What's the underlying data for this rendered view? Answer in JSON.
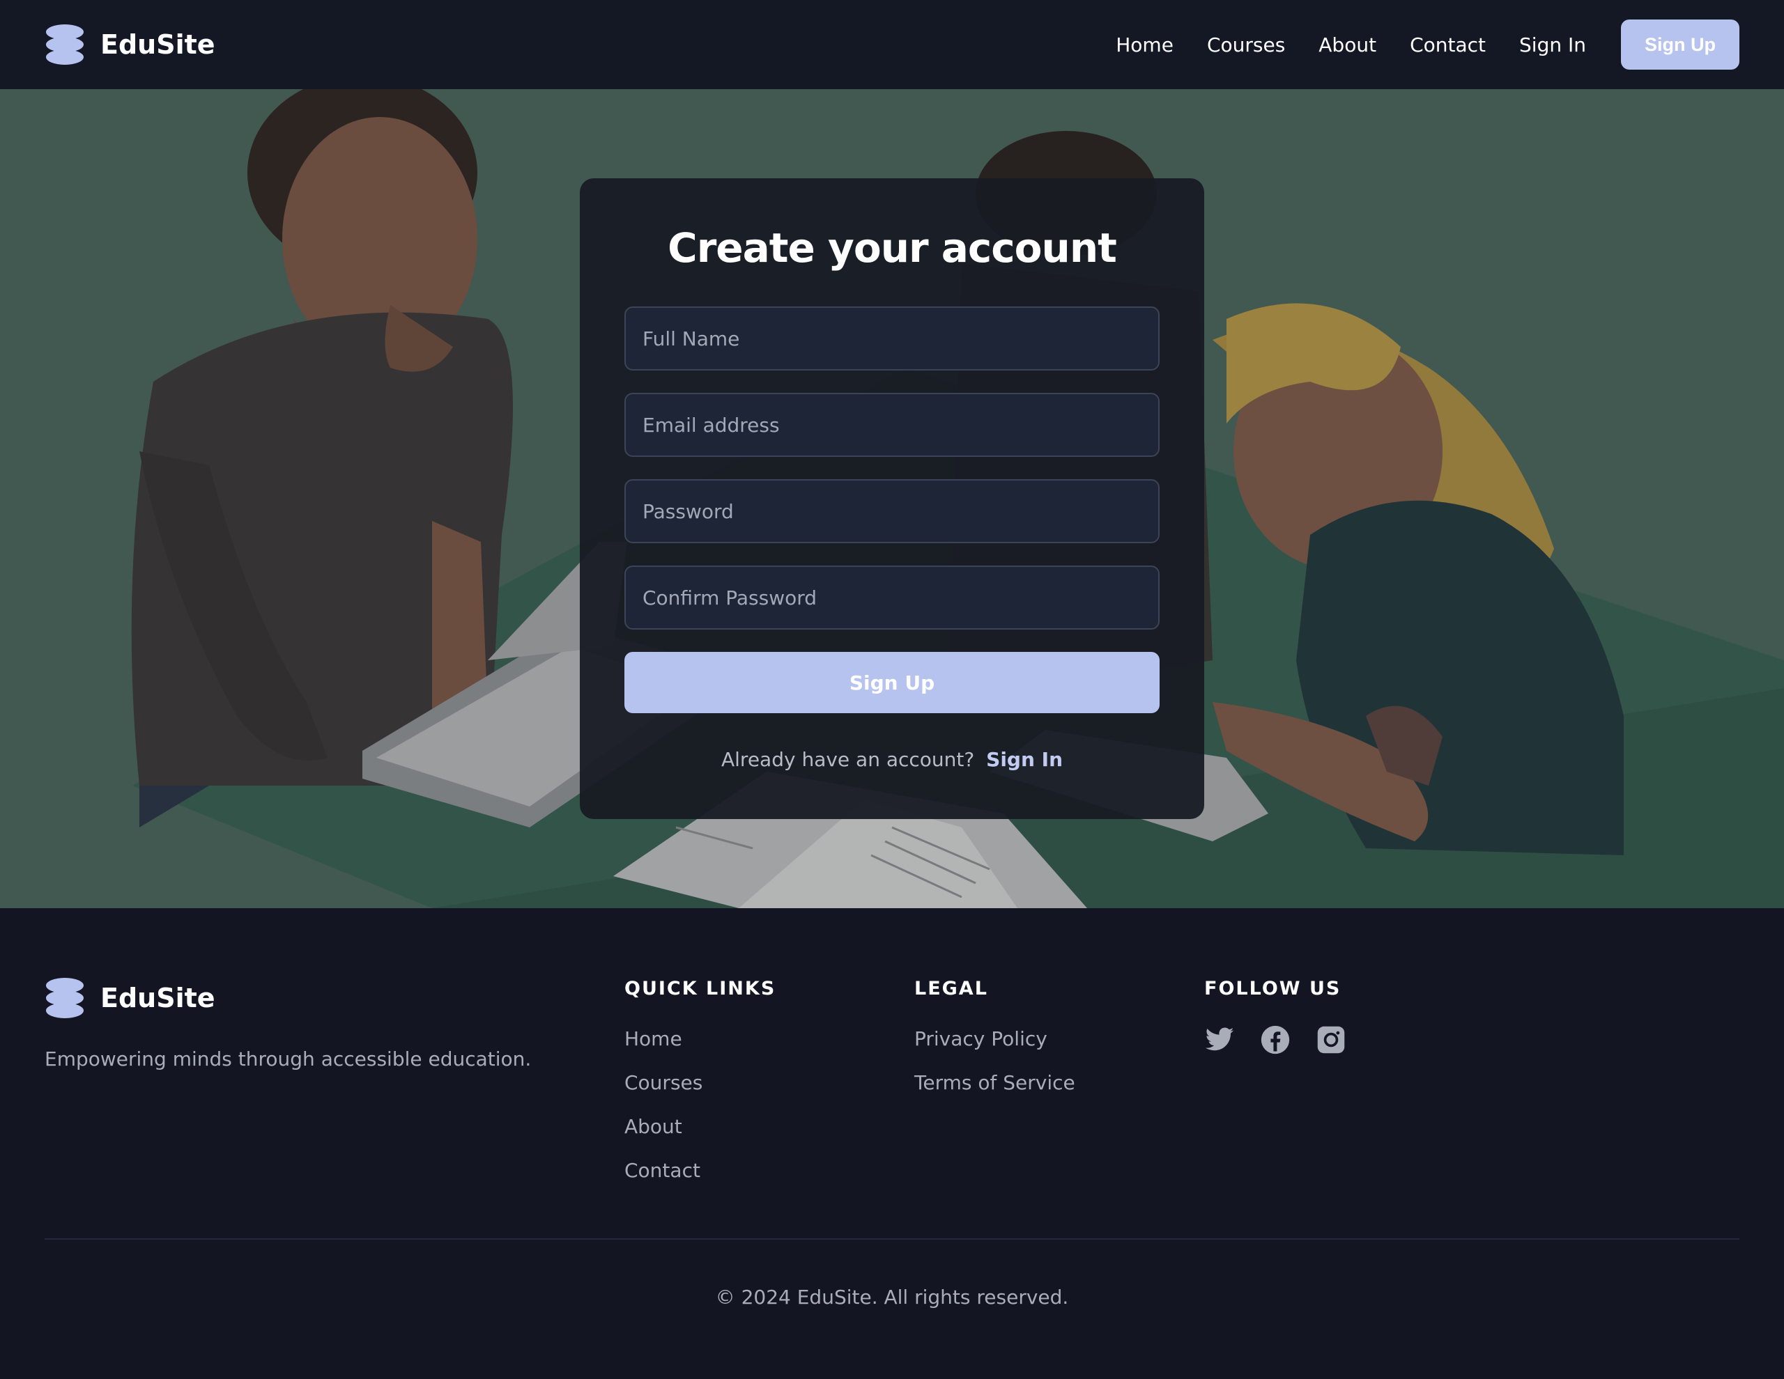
{
  "brand": {
    "name": "EduSite",
    "logo_icon": "stacked-layers-icon"
  },
  "nav": {
    "links": [
      "Home",
      "Courses",
      "About",
      "Contact",
      "Sign In"
    ],
    "signup_label": "Sign Up"
  },
  "form": {
    "title": "Create your account",
    "fields": {
      "full_name": {
        "placeholder": "Full Name",
        "value": ""
      },
      "email": {
        "placeholder": "Email address",
        "value": ""
      },
      "password": {
        "placeholder": "Password",
        "value": ""
      },
      "confirm_password": {
        "placeholder": "Confirm Password",
        "value": ""
      }
    },
    "submit_label": "Sign Up",
    "signin_prompt": "Already have an account?",
    "signin_link": "Sign In"
  },
  "footer": {
    "tagline": "Empowering minds through accessible education.",
    "quick_links": {
      "title": "QUICK LINKS",
      "items": [
        "Home",
        "Courses",
        "About",
        "Contact"
      ]
    },
    "legal": {
      "title": "LEGAL",
      "items": [
        "Privacy Policy",
        "Terms of Service"
      ]
    },
    "follow": {
      "title": "FOLLOW US",
      "icons": [
        "twitter-icon",
        "facebook-icon",
        "instagram-icon"
      ]
    },
    "copyright": "© 2024 EduSite. All rights reserved."
  },
  "colors": {
    "accent": "#b7c3ef",
    "background": "#131622",
    "card": "#181b24",
    "input": "#1e2537",
    "hero": "#466158"
  }
}
